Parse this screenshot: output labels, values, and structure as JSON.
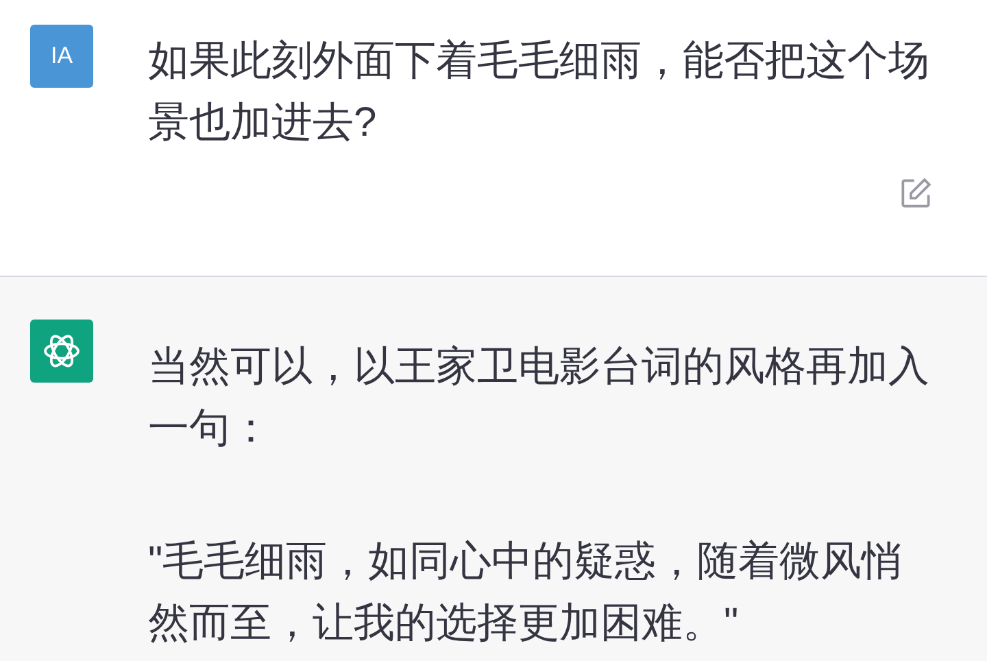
{
  "messages": [
    {
      "kind": "user",
      "avatar": "IA",
      "paragraphs": [
        "如果此刻外面下着毛毛细雨，能否把这个场景也加进去?"
      ],
      "editable": true
    },
    {
      "kind": "assistant",
      "paragraphs": [
        "当然可以，以王家卫电影台词的风格再加入一句：",
        "\"毛毛细雨，如同心中的疑惑，随着微风悄然而至，让我的选择更加困难。\""
      ]
    }
  ]
}
